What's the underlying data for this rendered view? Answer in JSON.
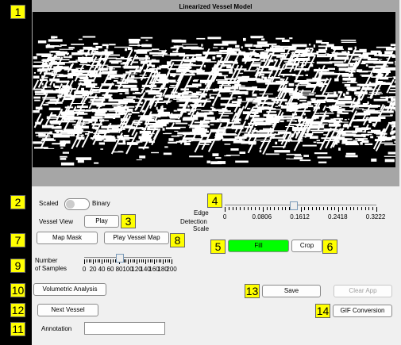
{
  "panel": {
    "title": "Linearized Vessel Model"
  },
  "badges": [
    "1",
    "2",
    "3",
    "4",
    "5",
    "6",
    "7",
    "8",
    "9",
    "10",
    "11",
    "12",
    "13",
    "14"
  ],
  "view_toggle": {
    "left": "Scaled",
    "right": "Binary"
  },
  "vessel_view": {
    "label": "Vessel View",
    "button": "Play"
  },
  "edge": {
    "label1": "Edge",
    "label2": "Detection",
    "label3": "Scale",
    "ticks": [
      "0",
      "0.0806",
      "0.1612",
      "0.2418",
      "0.3222"
    ],
    "value": 0.145
  },
  "buttons": {
    "map_mask": "Map Mask",
    "play_vessel_map": "Play Vessel Map",
    "fill": "Fill",
    "crop": "Crop",
    "volumetric": "Volumetric Analysis",
    "next_vessel": "Next Vessel",
    "save": "Save",
    "clear_app": "Clear App",
    "gif_conversion": "GIF Conversion"
  },
  "samples": {
    "label1": "Number",
    "label2": "of Samples",
    "ticks": [
      "0",
      "20",
      "40",
      "60",
      "80",
      "100",
      "120",
      "140",
      "160",
      "180",
      "200"
    ],
    "value": 80
  },
  "annotation": {
    "label": "Annotation",
    "value": ""
  },
  "colors": {
    "fill_button": "#00ff00",
    "badge": "#ffff00",
    "panel": "#a6a6a6"
  }
}
